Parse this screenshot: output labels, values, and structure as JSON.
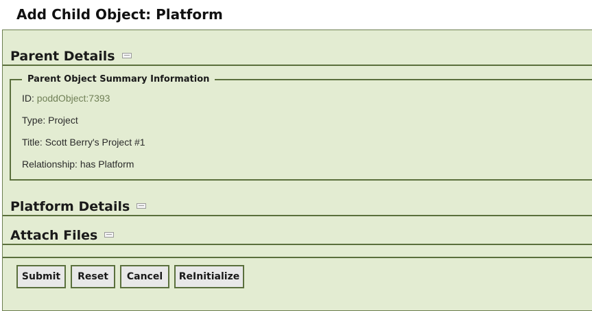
{
  "page": {
    "title": "Add Child Object: Platform"
  },
  "sections": {
    "parent_details": "Parent Details",
    "platform_details": "Platform Details",
    "attach_files": "Attach Files"
  },
  "summary": {
    "legend": "Parent Object Summary Information",
    "id_label": "ID: ",
    "id_value": "poddObject:7393",
    "type": "Type: Project",
    "title": "Title: Scott Berry's Project #1",
    "relationship": "Relationship: has Platform"
  },
  "buttons": {
    "submit": "Submit",
    "reset": "Reset",
    "cancel": "Cancel",
    "reinitialize": "ReInitialize"
  },
  "colors": {
    "panel_background": "#e3ecd2",
    "border": "#5a6f3c",
    "id_link": "#6f7f55"
  },
  "icons": {
    "section_toggle": "collapse-toggle-icon"
  }
}
